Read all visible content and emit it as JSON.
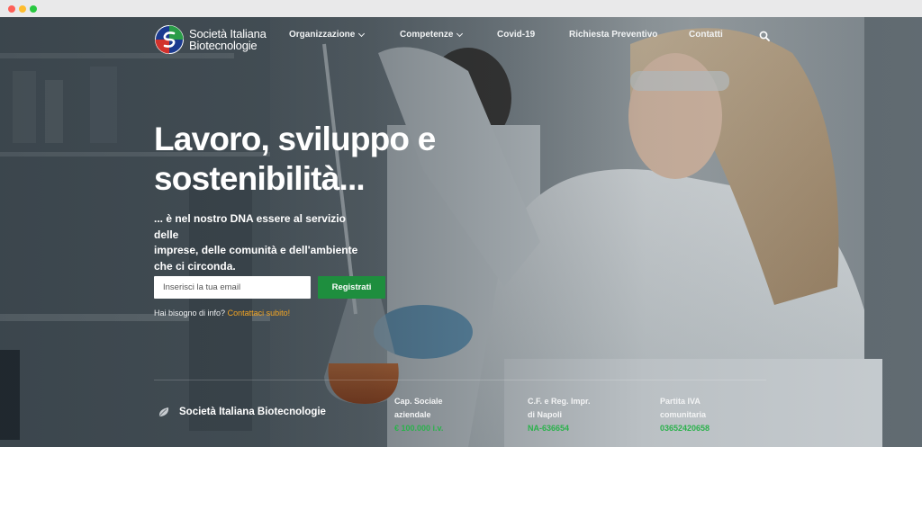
{
  "brand": {
    "line1": "Società Italiana",
    "line2": "Biotecnologie"
  },
  "nav": {
    "items": [
      {
        "label": "Organizzazione",
        "dropdown": true
      },
      {
        "label": "Competenze",
        "dropdown": true
      },
      {
        "label": "Covid-19",
        "dropdown": false
      },
      {
        "label": "Richiesta Preventivo",
        "dropdown": false
      },
      {
        "label": "Contatti",
        "dropdown": false
      }
    ],
    "search_icon": "search-icon"
  },
  "hero": {
    "headline_line1": "Lavoro, sviluppo e",
    "headline_line2": "sostenibilità...",
    "sub_line1": "... è nel nostro DNA essere al servizio delle",
    "sub_line2": "imprese, delle comunità e dell'ambiente",
    "sub_line3": "che ci circonda."
  },
  "form": {
    "email_placeholder": "Inserisci la tua email",
    "submit_label": "Registrati",
    "info_text": "Hai bisogno di info?",
    "info_link": "Contattaci subito!"
  },
  "footer": {
    "company": "Società Italiana Biotecnologie",
    "columns": [
      {
        "line1": "Cap. Sociale",
        "line2": "aziendale",
        "value": "€ 100.000 i.v."
      },
      {
        "line1": "C.F. e Reg. Impr.",
        "line2": "di Napoli",
        "value": "NA-636654"
      },
      {
        "line1": "Partita IVA",
        "line2": "comunitaria",
        "value": "03652420658"
      }
    ]
  },
  "colors": {
    "accent_green": "#1e8e3e",
    "link_orange": "#f5a623",
    "value_green": "#2bb24c"
  }
}
